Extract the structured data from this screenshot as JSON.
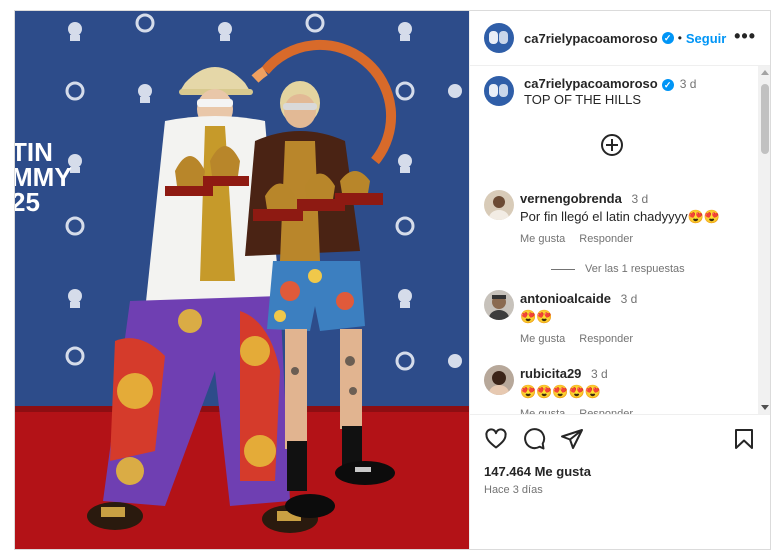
{
  "post": {
    "username": "ca7rielypacoamoroso",
    "verified_badge": "✓",
    "separator": "•",
    "follow_label": "Seguir",
    "more_label": "•••"
  },
  "caption": {
    "username": "ca7rielypacoamoroso",
    "time": "3 d",
    "text": "TOP OF THE HILLS"
  },
  "comments": [
    {
      "username": "vernengobrenda",
      "time": "3 d",
      "text": "Por fin llegó el latin chadyyyy😍😍",
      "like_label": "Me gusta",
      "reply_label": "Responder"
    },
    {
      "username": "antonioalcaide",
      "time": "3 d",
      "text": "😍😍",
      "like_label": "Me gusta",
      "reply_label": "Responder"
    },
    {
      "username": "rubicita29",
      "time": "3 d",
      "text": "😍😍😍😍😍",
      "like_label": "Me gusta",
      "reply_label": "Responder"
    }
  ],
  "view_replies_label": "Ver las 1 respuestas",
  "footer": {
    "likes": "147.464 Me gusta",
    "ago": "Hace 3 días"
  },
  "photo_text": {
    "backdrop_text": "TIN\nMMY\n25"
  },
  "colors": {
    "accent": "#0095f6",
    "backdrop": "#2b4a86",
    "carpet": "#b31217"
  }
}
